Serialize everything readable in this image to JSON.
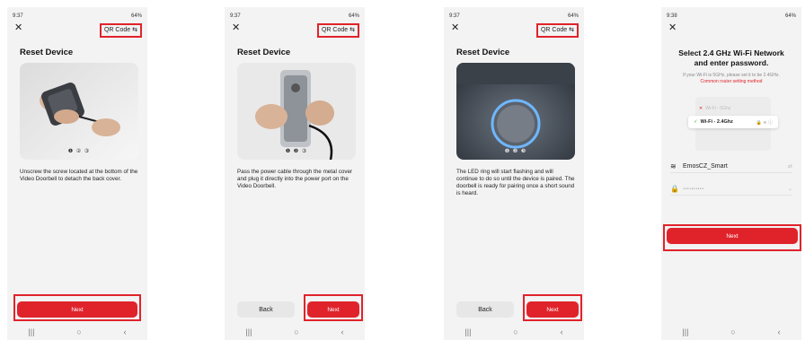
{
  "screens": [
    {
      "status_time": "9:37",
      "status_right": "64%",
      "qr_label": "QR Code",
      "title": "Reset Device",
      "pager": "❶ ② ③",
      "description": "Unscrew the screw located at the bottom of the Video Doorbell to detach the back cover.",
      "next_label": "Next"
    },
    {
      "status_time": "9:37",
      "status_right": "64%",
      "qr_label": "QR Code",
      "title": "Reset Device",
      "pager": "❶ ❷ ③",
      "description": "Pass the power cable through the metal cover and plug it directly into the power port on the Video Doorbell.",
      "back_label": "Back",
      "next_label": "Next"
    },
    {
      "status_time": "9:37",
      "status_right": "64%",
      "qr_label": "QR Code",
      "title": "Reset Device",
      "pager": "❶ ❷ ❸",
      "description": "The LED ring will start flashing and will continue to do so until the device is paired. The doorbell is ready for pairing once a short sound is heard.",
      "back_label": "Back",
      "next_label": "Next"
    },
    {
      "status_time": "9:38",
      "status_right": "64%",
      "title": "Select 2.4 GHz Wi-Fi Network and enter password.",
      "hint": "If your Wi-Fi is 5GHz, please set it to be 2.4GHz.",
      "hint_link": "Common router setting method",
      "wifi_5g": "Wi-Fi - 5Ghz",
      "wifi_24g": "Wi-Fi - 2.4Ghz",
      "network_name": "EmosCZ_Smart",
      "password_mask": "··········",
      "next_label": "Next"
    }
  ],
  "nav_icons": [
    "recent-apps-icon",
    "home-icon",
    "back-icon"
  ],
  "colors": {
    "accent": "#e0232b",
    "background": "#f3f3f3",
    "button_grey": "#e7e7e7"
  }
}
